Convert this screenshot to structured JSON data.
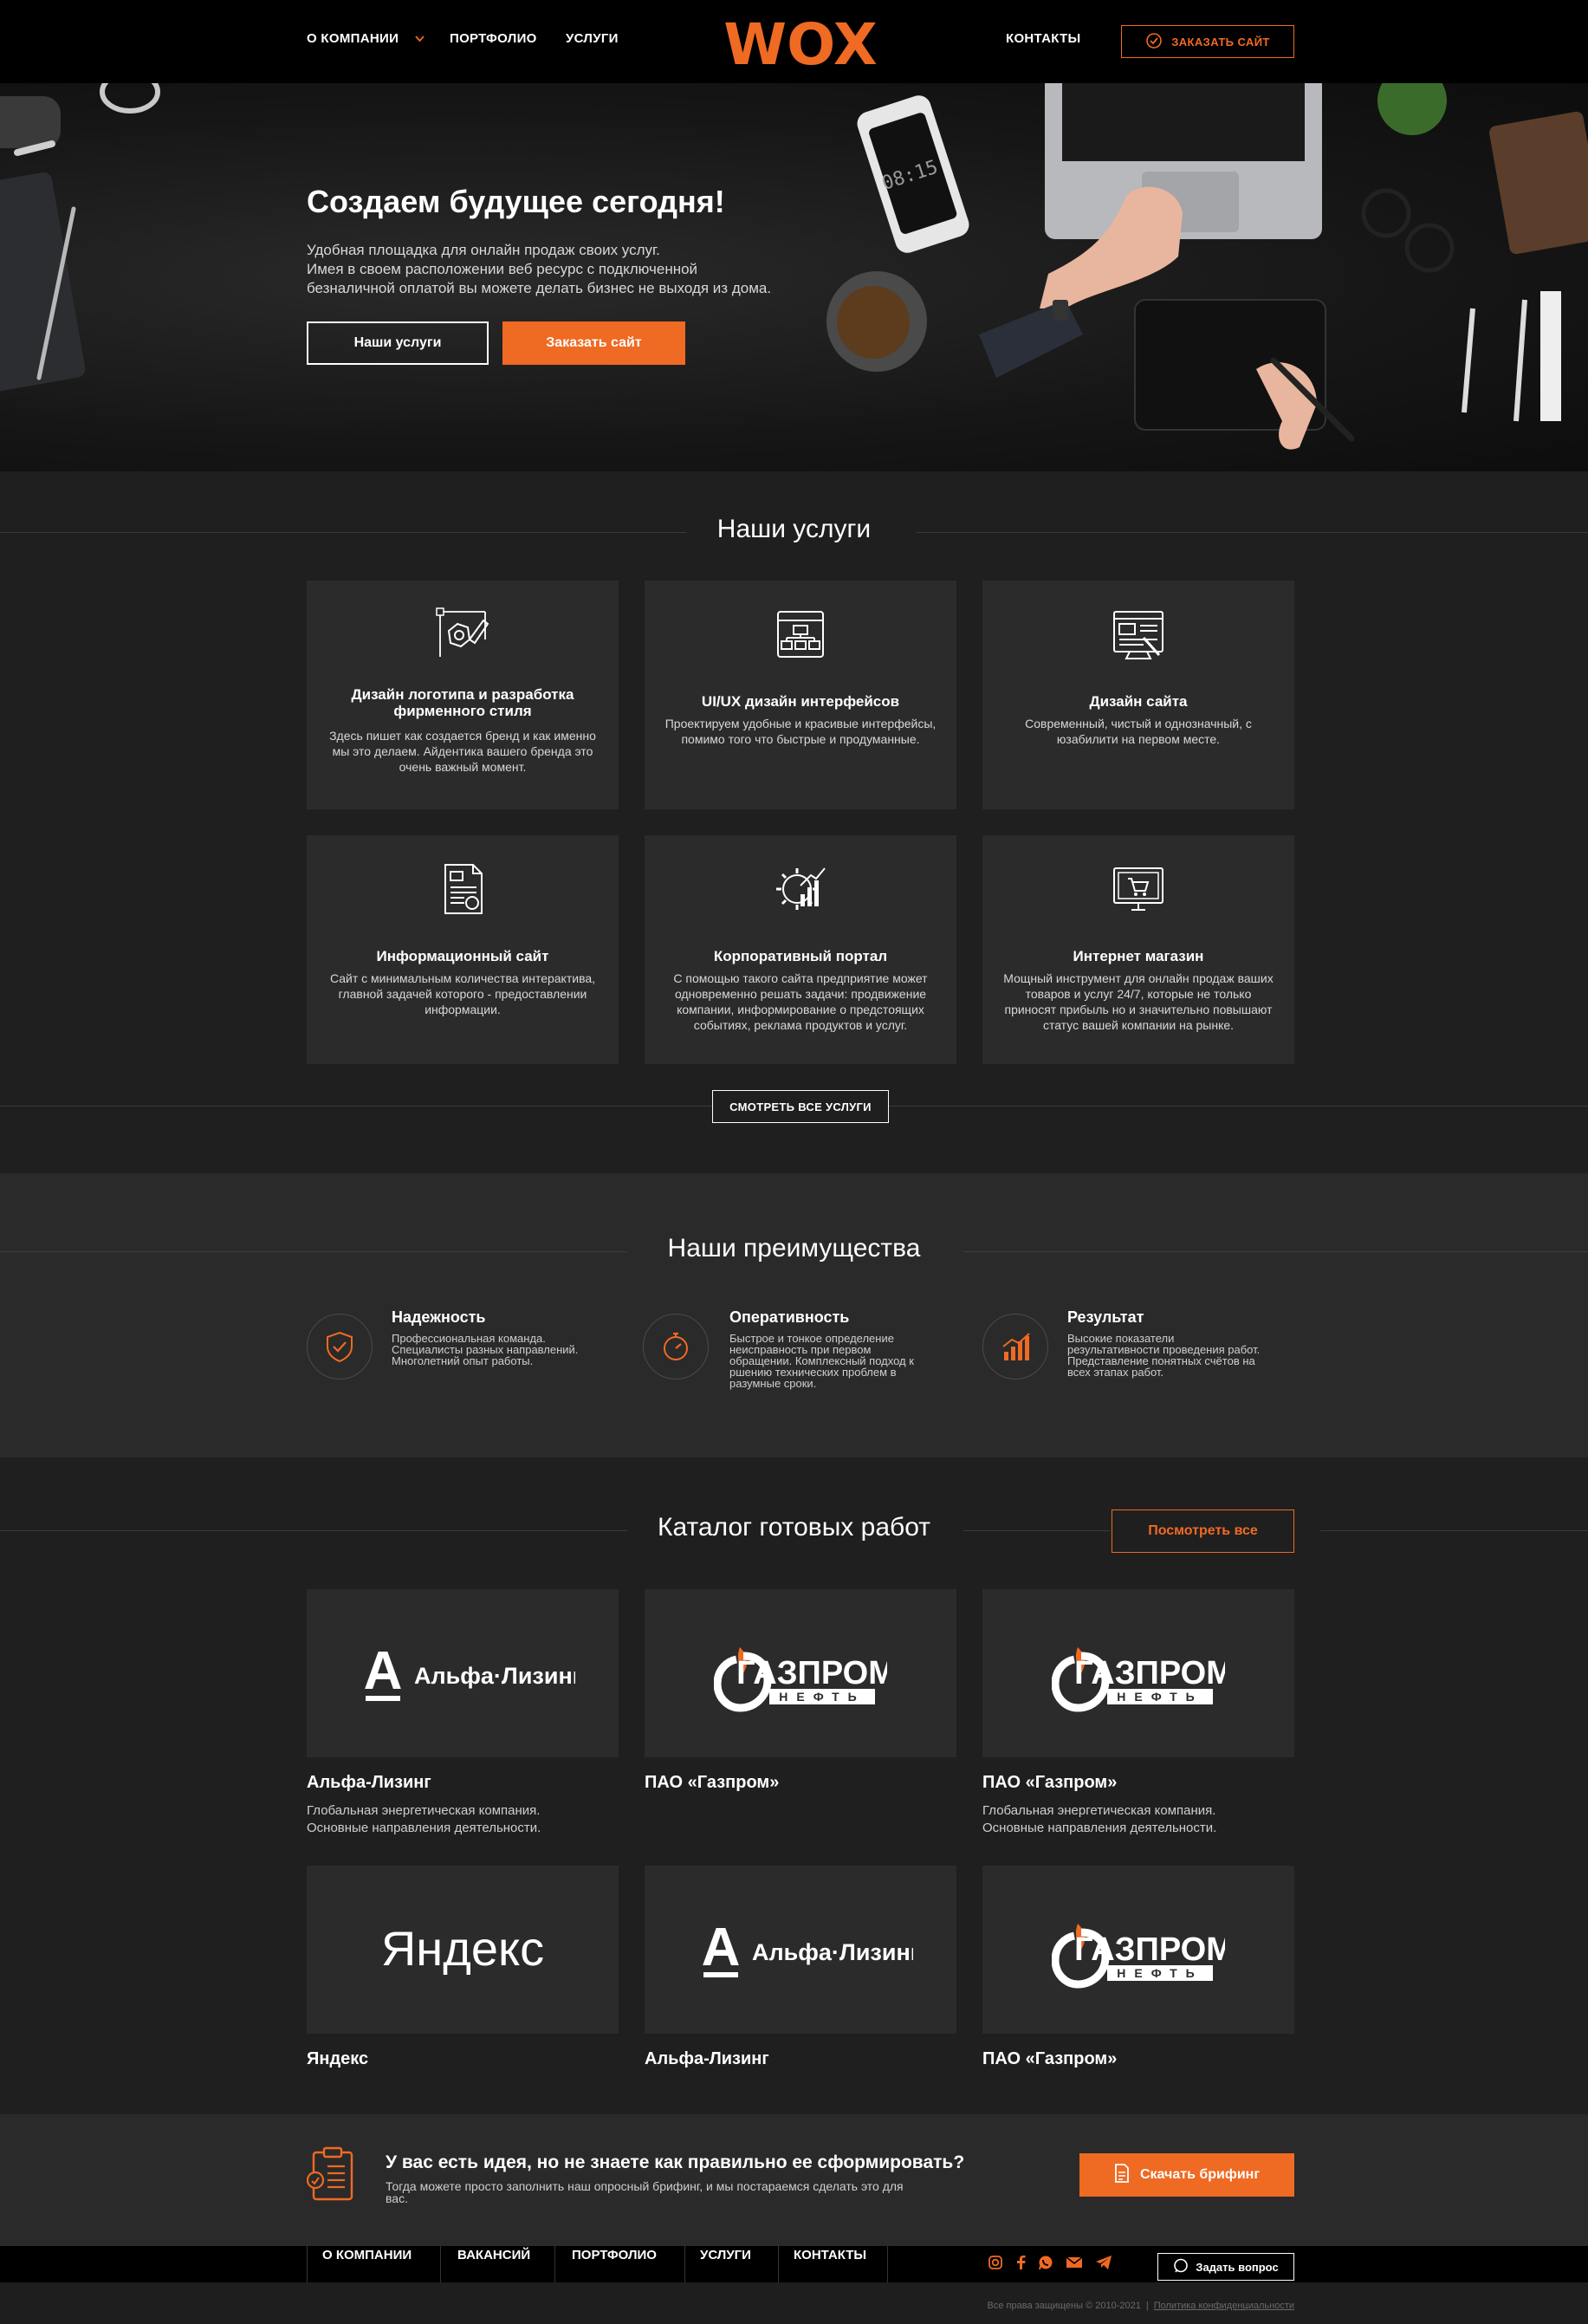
{
  "header": {
    "nav_left": [
      "О КОМПАНИИ",
      "ПОРТФОЛИО",
      "УСЛУГИ"
    ],
    "logo_text": "WOX",
    "nav_right": "КОНТАКТЫ",
    "order_button": "ЗАКАЗАТЬ САЙТ"
  },
  "hero": {
    "title": "Создаем будущее сегодня!",
    "text": [
      "Удобная площадка для онлайн продаж своих услуг.",
      "Имея в своем расположении веб ресурс с подключенной",
      "безналичной оплатой вы можете делать бизнес не выходя из дома."
    ],
    "btn_services": "Наши услуги",
    "btn_order": "Заказать сайт",
    "phone_time": "08:15"
  },
  "services": {
    "title": "Наши услуги",
    "items": [
      {
        "title": "Дизайн логотипа и разработка фирменного стиля",
        "desc": "Здесь пишет как создается бренд и как именно мы это делаем. Айдентика вашего бренда это очень важный момент.",
        "icon": "logo-design-icon"
      },
      {
        "title": "UI/UX дизайн интерфейсов",
        "desc": "Проектируем удобные и красивые интерфейсы, помимо того что быстрые и продуманные.",
        "icon": "ui-ux-icon"
      },
      {
        "title": "Дизайн сайта",
        "desc": "Современный, чистый и однозначный, с юзабилити на первом месте.",
        "icon": "web-design-icon"
      },
      {
        "title": "Информационный сайт",
        "desc": "Сайт с минимальным количества интерактива, главной задачей которого - предоставлении информации.",
        "icon": "info-site-icon"
      },
      {
        "title": "Корпоративный портал",
        "desc": "С помощью такого сайта предприятие может одновременно решать задачи: продвижение компании, информирование о предстоящих событиях, реклама продуктов и услуг.",
        "icon": "portal-icon"
      },
      {
        "title": "Интернет магазин",
        "desc": "Мощный инструмент для онлайн продаж ваших товаров и услуг 24/7, которые не только приносят прибыль но и значительно повышают статус вашей компании на рынке.",
        "icon": "shop-icon"
      }
    ],
    "all_button": "СМОТРЕТЬ ВСЕ УСЛУГИ"
  },
  "advantages": {
    "title": "Наши преимущества",
    "items": [
      {
        "title": "Надежность",
        "text": [
          "Профессиональная команда.",
          "Специалисты разных направлений.",
          "Многолетний опыт работы."
        ],
        "icon": "shield-icon"
      },
      {
        "title": "Оперативность",
        "text": [
          "Быстрое и тонкое определение",
          "неисправность при первом",
          "обращении. Комплексный подход к",
          "ршению технических проблем в",
          "разумные сроки."
        ],
        "icon": "stopwatch-icon"
      },
      {
        "title": "Результат",
        "text": [
          "Высокие показатели",
          "результативности проведения работ.",
          "Представление понятных счётов на",
          "всех этапах работ."
        ],
        "icon": "chart-icon"
      }
    ]
  },
  "catalog": {
    "title": "Каталог готовых работ",
    "view_all": "Посмотреть все",
    "items": [
      {
        "name": "Альфа-Лизинг",
        "desc": [
          "Глобальная энергетическая компания.",
          "Основные направления деятельности."
        ],
        "logo": "alfa",
        "logo_text": "Альфа·Лизинг"
      },
      {
        "name": "ПАО «Газпром»",
        "desc": [],
        "logo": "gazprom",
        "logo_text": "ГАЗПРОМ",
        "logo_sub": "НЕФТЬ"
      },
      {
        "name": "ПАО «Газпром»",
        "desc": [
          "Глобальная энергетическая компания.",
          "Основные направления деятельности."
        ],
        "logo": "gazprom",
        "logo_text": "ГАЗПРОМ",
        "logo_sub": "НЕФТЬ"
      },
      {
        "name": "Яндекс",
        "desc": [],
        "logo": "yandex",
        "logo_text": "Яндекс"
      },
      {
        "name": "Альфа-Лизинг",
        "desc": [],
        "logo": "alfa",
        "logo_text": "Альфа·Лизинг"
      },
      {
        "name": "ПАО «Газпром»",
        "desc": [],
        "logo": "gazprom",
        "logo_text": "ГАЗПРОМ",
        "logo_sub": "НЕФТЬ"
      }
    ]
  },
  "brief": {
    "title": "У вас есть идея, но не знаете как правильно ее сформировать?",
    "text": [
      "Тогда можете просто заполнить наш опросный брифинг, и мы постараемся сделать это для",
      "вас."
    ],
    "button": "Скачать брифинг"
  },
  "footer": {
    "nav": [
      "О КОМПАНИИ",
      "ВАКАНСИЙ",
      "ПОРТФОЛИО",
      "УСЛУГИ",
      "КОНТАКТЫ"
    ],
    "socials": [
      "instagram-icon",
      "facebook-icon",
      "whatsapp-icon",
      "mail-icon",
      "telegram-icon"
    ],
    "ask_button": "Задать вопрос",
    "copyright": "Все права защищены © 2010-2021",
    "separator": "|",
    "privacy": "Политика конфиденциальности"
  },
  "colors": {
    "accent": "#ef6a23",
    "bg": "#1e1e1e",
    "card": "#2b2b2b",
    "header": "#000000"
  }
}
